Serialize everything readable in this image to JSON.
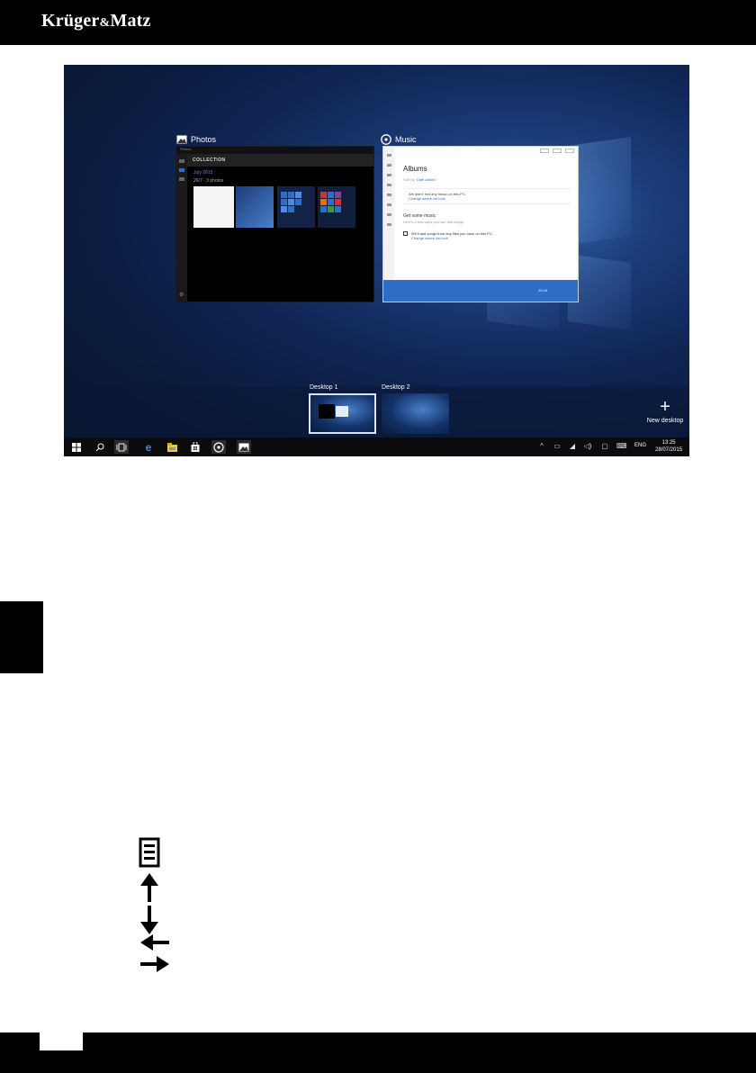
{
  "brand": {
    "name": "Krüger",
    "amp": "&",
    "name2": "Matz"
  },
  "screen": {
    "windows": {
      "photos": {
        "label": "Photos",
        "titlebar": "Photos",
        "header": "COLLECTION",
        "sub1": "July 2015",
        "sub2": "26/7 · 3 photos"
      },
      "music": {
        "label": "Music",
        "title": "Albums",
        "filters_prefix": "Sort by:",
        "filters_value": "Date added",
        "info_text": "We didn't find any music on this PC.",
        "info_link": "Change where we look",
        "get_title": "Get some music",
        "get_sub": "Here's a few ways you can add songs",
        "add_text": "We'll add songs from any files you have on this PC.",
        "add_link": "Change where we look",
        "player_time": "35:48"
      }
    },
    "desktops": [
      {
        "label": "Desktop 1",
        "active": true
      },
      {
        "label": "Desktop 2",
        "active": false
      }
    ],
    "new_desktop": "New desktop",
    "taskbar": {
      "language": "ENG",
      "time": "13:25",
      "date": "28/07/2015"
    }
  },
  "legend_icons": [
    "menu-key-icon",
    "arrow-up-icon",
    "arrow-down-icon",
    "arrow-left-icon",
    "arrow-right-icon"
  ]
}
